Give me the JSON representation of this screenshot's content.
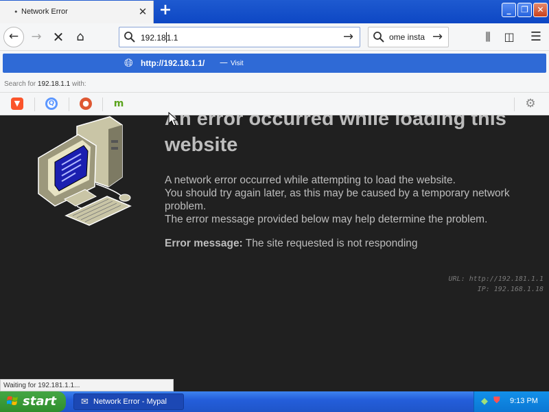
{
  "browser": {
    "tab": {
      "title": "Network Error",
      "dot": "•",
      "close": "✕"
    },
    "new_tab": "+",
    "window_buttons": {
      "minimize": "_",
      "maximize": "❐",
      "close": "✕"
    },
    "nav": {
      "back": "←",
      "forward": "→",
      "stop": "✕",
      "home": "⌂"
    },
    "url_bar": {
      "value_before_caret": "192.18",
      "value_after_caret": "1.1",
      "go": "→"
    },
    "search_bar": {
      "value": "ome insta",
      "go": "→"
    },
    "toolbar_icons": {
      "library": "⫼",
      "sidebar": "◫",
      "menu": "☰"
    }
  },
  "dropdown": {
    "visit_url": "http://192.18.1.1/",
    "separator": "—",
    "visit_label": "Visit",
    "search_for_prefix": "Search for",
    "search_for_query": "192.18.1.1",
    "search_for_suffix": "with:",
    "engines": [
      "brave",
      "qwant",
      "duckduckgo",
      "mojeek"
    ],
    "engine_glyphs": {
      "brave": "▼",
      "qwant": "Q",
      "duckduckgo": "●",
      "mojeek": "m",
      "settings": "⚙"
    }
  },
  "error_page": {
    "title": "An error occurred while loading this website",
    "lines": [
      "A network error occurred while attempting to load the website.",
      "You should try again later, as this may be caused by a temporary network",
      "problem.",
      "The error message provided below may help determine the problem."
    ],
    "error_label": "Error message:",
    "error_text": "The site requested is not responding",
    "url_line": "URL: http://192.181.1.1",
    "ip_line": "IP: 192.168.1.18"
  },
  "status_bar": {
    "text": "Waiting for 192.181.1.1..."
  },
  "taskbar": {
    "start_label": "start",
    "window_label": "Network Error - Mypal",
    "clock": "9:13 PM"
  },
  "colors": {
    "accent": "#2f6ad6",
    "page_bg": "#202020",
    "page_text": "#bdbdbd",
    "taskbar": "#245edb",
    "start": "#3c9a3a"
  }
}
